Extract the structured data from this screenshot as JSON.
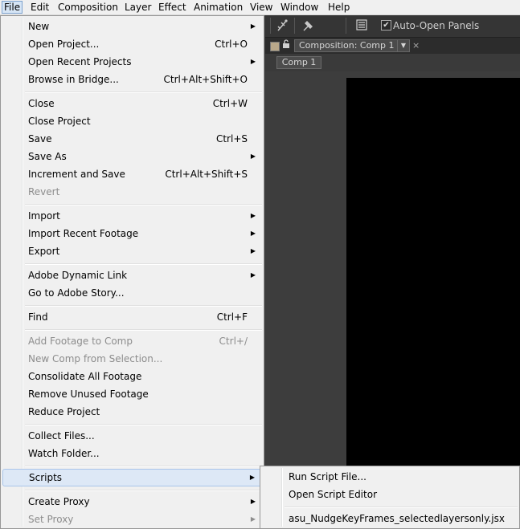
{
  "menubar": {
    "items": [
      "File",
      "Edit",
      "Composition",
      "Layer",
      "Effect",
      "Animation",
      "View",
      "Window",
      "Help"
    ]
  },
  "toolbar": {
    "auto_open_panels": "Auto-Open Panels",
    "auto_open_checked": true
  },
  "composition_panel": {
    "tab_label": "Composition: Comp 1",
    "comp_button": "Comp 1"
  },
  "file_menu": {
    "items": [
      {
        "label": "New",
        "shortcut": "",
        "submenu": true,
        "disabled": false
      },
      {
        "label": "Open Project...",
        "shortcut": "Ctrl+O",
        "submenu": false,
        "disabled": false
      },
      {
        "label": "Open Recent Projects",
        "shortcut": "",
        "submenu": true,
        "disabled": false
      },
      {
        "label": "Browse in Bridge...",
        "shortcut": "Ctrl+Alt+Shift+O",
        "submenu": false,
        "disabled": false
      },
      {
        "label": "Close",
        "shortcut": "Ctrl+W",
        "submenu": false,
        "disabled": false
      },
      {
        "label": "Close Project",
        "shortcut": "",
        "submenu": false,
        "disabled": false
      },
      {
        "label": "Save",
        "shortcut": "Ctrl+S",
        "submenu": false,
        "disabled": false
      },
      {
        "label": "Save As",
        "shortcut": "",
        "submenu": true,
        "disabled": false
      },
      {
        "label": "Increment and Save",
        "shortcut": "Ctrl+Alt+Shift+S",
        "submenu": false,
        "disabled": false
      },
      {
        "label": "Revert",
        "shortcut": "",
        "submenu": false,
        "disabled": true
      },
      {
        "label": "Import",
        "shortcut": "",
        "submenu": true,
        "disabled": false
      },
      {
        "label": "Import Recent Footage",
        "shortcut": "",
        "submenu": true,
        "disabled": false
      },
      {
        "label": "Export",
        "shortcut": "",
        "submenu": true,
        "disabled": false
      },
      {
        "label": "Adobe Dynamic Link",
        "shortcut": "",
        "submenu": true,
        "disabled": false
      },
      {
        "label": "Go to Adobe Story...",
        "shortcut": "",
        "submenu": false,
        "disabled": false
      },
      {
        "label": "Find",
        "shortcut": "Ctrl+F",
        "submenu": false,
        "disabled": false
      },
      {
        "label": "Add Footage to Comp",
        "shortcut": "Ctrl+/",
        "submenu": false,
        "disabled": true
      },
      {
        "label": "New Comp from Selection...",
        "shortcut": "",
        "submenu": false,
        "disabled": true
      },
      {
        "label": "Consolidate All Footage",
        "shortcut": "",
        "submenu": false,
        "disabled": false
      },
      {
        "label": "Remove Unused Footage",
        "shortcut": "",
        "submenu": false,
        "disabled": false
      },
      {
        "label": "Reduce Project",
        "shortcut": "",
        "submenu": false,
        "disabled": false
      },
      {
        "label": "Collect Files...",
        "shortcut": "",
        "submenu": false,
        "disabled": false
      },
      {
        "label": "Watch Folder...",
        "shortcut": "",
        "submenu": false,
        "disabled": false
      },
      {
        "label": "Scripts",
        "shortcut": "",
        "submenu": true,
        "disabled": false
      },
      {
        "label": "Create Proxy",
        "shortcut": "",
        "submenu": true,
        "disabled": false
      },
      {
        "label": "Set Proxy",
        "shortcut": "",
        "submenu": true,
        "disabled": true
      }
    ]
  },
  "scripts_submenu": {
    "items": [
      "Run Script File...",
      "Open Script Editor",
      "asu_NudgeKeyFrames_selectedlayersonly.jsx"
    ]
  },
  "icons": {
    "submenu_arrow": "▶",
    "dropdown_arrow": "▼",
    "check": "✔",
    "close": "×"
  }
}
